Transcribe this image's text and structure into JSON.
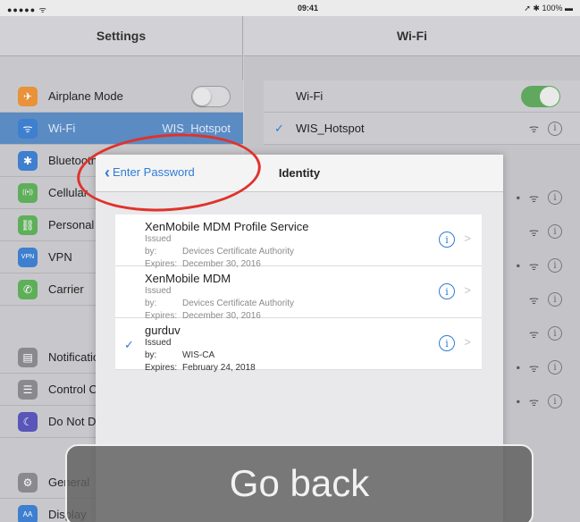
{
  "status_bar": {
    "signal": "●●●●● ᯤ",
    "time": "09:41",
    "battery": "➚ ✱ 100% ▬"
  },
  "sidebar": {
    "title": "Settings",
    "items": [
      {
        "label": "Airplane Mode",
        "value": "",
        "icon": "airplane-icon",
        "glyph": "✈",
        "color": "#e8923a"
      },
      {
        "label": "Wi-Fi",
        "value": "WIS_Hotspot",
        "icon": "wifi-icon",
        "glyph": "ᯤ",
        "color": "#3e7fcf"
      },
      {
        "label": "Bluetooth",
        "value": "",
        "icon": "bluetooth-icon",
        "glyph": "✱",
        "color": "#3e7fcf"
      },
      {
        "label": "Cellular",
        "value": "",
        "icon": "cellular-icon",
        "glyph": "((•))",
        "color": "#5fae5a"
      },
      {
        "label": "Personal Hotspot",
        "value": "",
        "icon": "hotspot-icon",
        "glyph": "⛓",
        "color": "#5fae5a"
      },
      {
        "label": "VPN",
        "value": "",
        "icon": "vpn-icon",
        "glyph": "VPN",
        "color": "#3e7fcf"
      },
      {
        "label": "Carrier",
        "value": "",
        "icon": "phone-icon",
        "glyph": "✆",
        "color": "#5fae5a"
      },
      {
        "label": "Notifications",
        "value": "",
        "icon": "notifications-icon",
        "glyph": "▤",
        "color": "#8a8a8e"
      },
      {
        "label": "Control Center",
        "value": "",
        "icon": "control-center-icon",
        "glyph": "☰",
        "color": "#8a8a8e"
      },
      {
        "label": "Do Not Disturb",
        "value": "",
        "icon": "moon-icon",
        "glyph": "☾",
        "color": "#5a55b8"
      },
      {
        "label": "General",
        "value": "",
        "icon": "gear-icon",
        "glyph": "⚙",
        "color": "#8a8a8e"
      },
      {
        "label": "Display",
        "value": "",
        "icon": "display-icon",
        "glyph": "AA",
        "color": "#3e7fcf"
      }
    ]
  },
  "wifi": {
    "title": "Wi-Fi",
    "toggle_label": "Wi-Fi",
    "current_network": "WIS_Hotspot"
  },
  "dialog": {
    "back_label": "Enter Password",
    "title": "Identity",
    "issued_key": "Issued by:",
    "expires_key": "Expires:",
    "certificates": [
      {
        "name": "XenMobile MDM Profile Service",
        "issuer": "Devices Certificate Authority",
        "expires": "December 30, 2016",
        "selected": false
      },
      {
        "name": "XenMobile MDM",
        "issuer": "Devices Certificate Authority",
        "expires": "December 30, 2016",
        "selected": false
      },
      {
        "name": "gurduv",
        "issuer": "WIS-CA",
        "expires": "February 24, 2018",
        "selected": true
      }
    ]
  },
  "overlay": {
    "go_back": "Go back"
  }
}
